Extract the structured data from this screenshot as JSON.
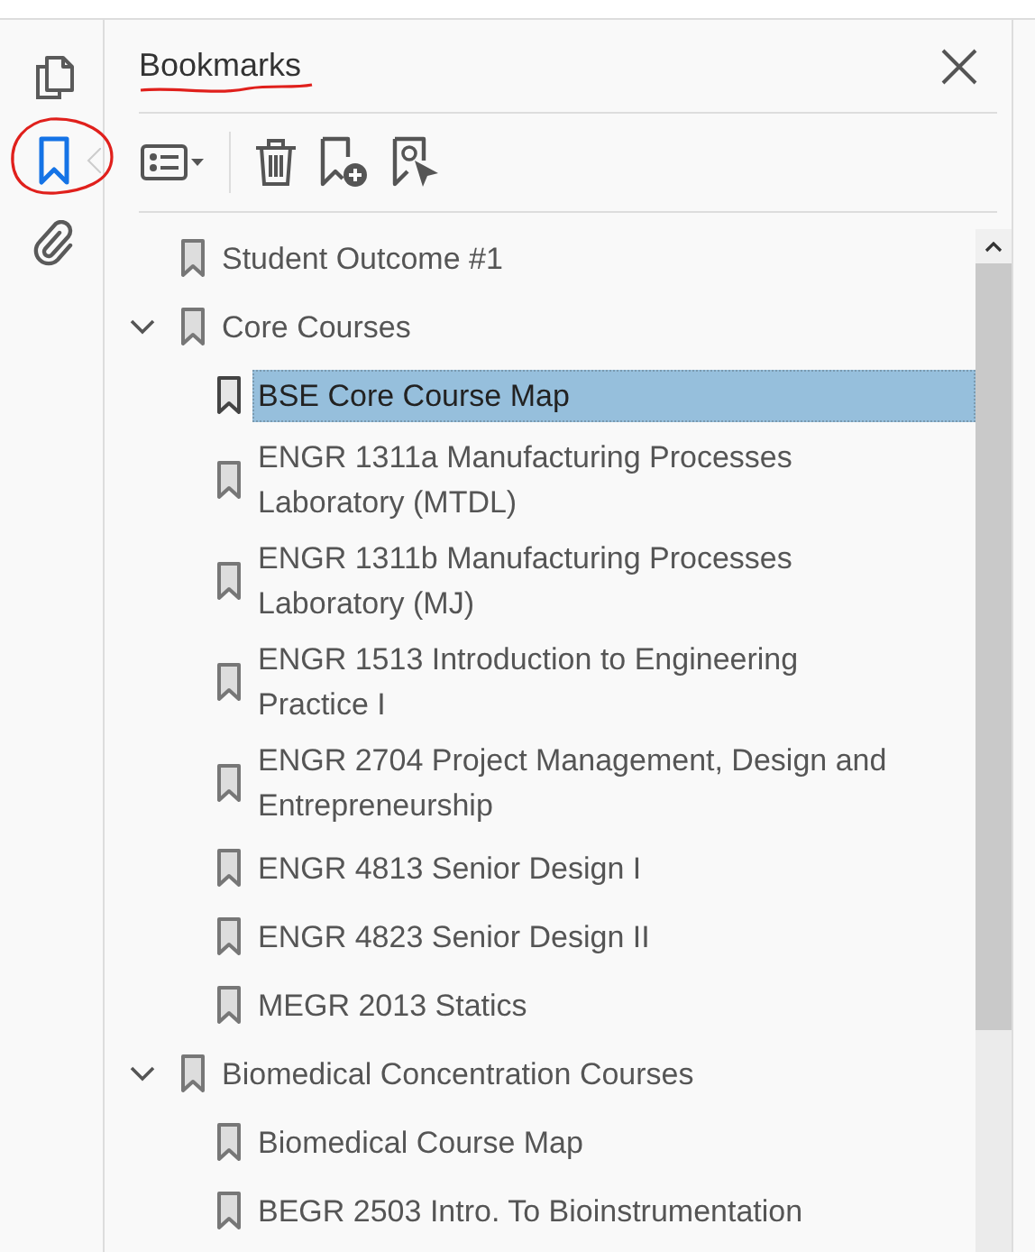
{
  "sidebar": {
    "items": [
      {
        "kind": "pages",
        "selected": false
      },
      {
        "kind": "bookmarks",
        "selected": true
      },
      {
        "kind": "attachments",
        "selected": false
      }
    ]
  },
  "panel": {
    "title": "Bookmarks"
  },
  "bookmarks": [
    {
      "title": "Student Outcome #1",
      "selected": false
    },
    {
      "title": "Core Courses",
      "selected": false,
      "expanded": true,
      "children": [
        {
          "title": "BSE Core Course Map",
          "selected": true
        },
        {
          "title": "ENGR 1311a Manufacturing Processes Laboratory (MTDL)",
          "selected": false
        },
        {
          "title": "ENGR 1311b Manufacturing Processes Laboratory (MJ)",
          "selected": false
        },
        {
          "title": "ENGR 1513 Introduction to Engineering Practice I",
          "selected": false
        },
        {
          "title": "ENGR 2704 Project Management, Design and Entrepreneurship",
          "selected": false
        },
        {
          "title": "ENGR 4813 Senior Design I",
          "selected": false
        },
        {
          "title": "ENGR 4823 Senior Design II",
          "selected": false
        },
        {
          "title": "MEGR 2013 Statics",
          "selected": false
        }
      ]
    },
    {
      "title": "Biomedical Concentration Courses",
      "selected": false,
      "expanded": true,
      "children": [
        {
          "title": "Biomedical Course Map",
          "selected": false
        },
        {
          "title": "BEGR 2503 Intro. To Bioinstrumentation",
          "selected": false
        }
      ]
    }
  ]
}
